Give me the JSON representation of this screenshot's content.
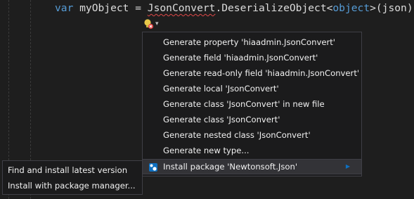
{
  "code": {
    "kw_var": "var",
    "ident": " myObject = ",
    "err_token": "JsonConvert",
    "method": ".DeserializeObject<",
    "kw_object": "object",
    "tail": ">(json);"
  },
  "lightbulb": {
    "icon": "lightbulb-error-icon",
    "chevron": "▾"
  },
  "menu": {
    "items": [
      "Generate property 'hiaadmin.JsonConvert'",
      "Generate field 'hiaadmin.JsonConvert'",
      "Generate read-only field 'hiaadmin.JsonConvert'",
      "Generate local 'JsonConvert'",
      "Generate class 'JsonConvert' in new file",
      "Generate class 'JsonConvert'",
      "Generate nested class 'JsonConvert'",
      "Generate new type...",
      "Install package 'Newtonsoft.Json'"
    ],
    "submenu_arrow": "▶"
  },
  "submenu": {
    "items": [
      "Find and install latest version",
      "Install with package manager..."
    ]
  },
  "colors": {
    "editor_bg": "#1e1e1e",
    "keyword": "#569cd6",
    "error_squiggle": "#e04848",
    "menu_bg": "#1b1b1c",
    "menu_border": "#3f3f46",
    "highlight_bg": "#333337"
  }
}
